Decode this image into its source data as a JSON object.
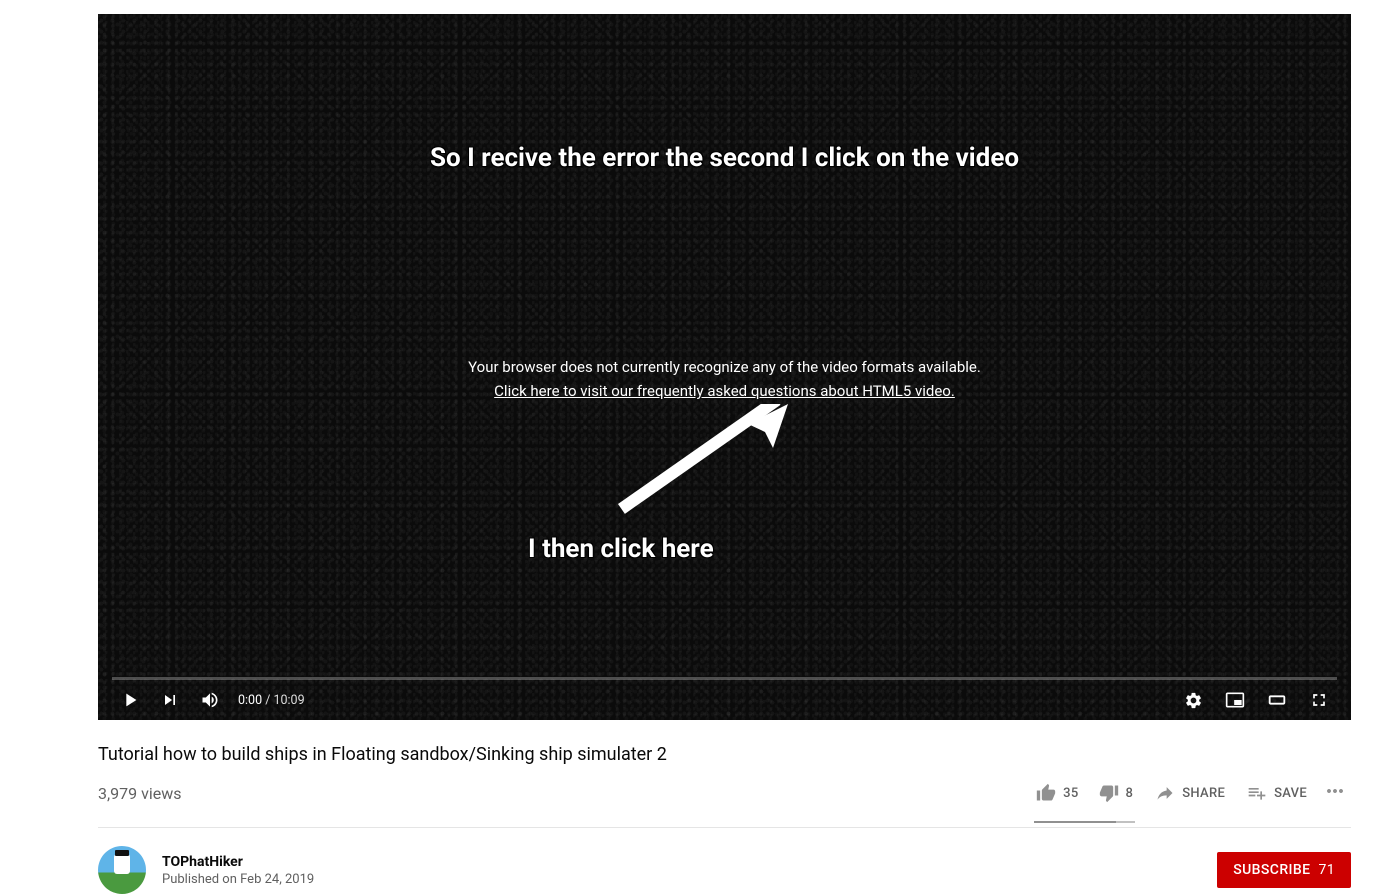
{
  "player": {
    "annotation_top": "So I recive the error the second I click on the video",
    "error_message": "Your browser does not currently recognize any of the video formats available.",
    "error_link": "Click here to visit our frequently asked questions about HTML5 video.",
    "annotation_bottom": "I then click here",
    "current_time": "0:00",
    "duration": "10:09"
  },
  "video": {
    "title": "Tutorial how to build ships in Floating sandbox/Sinking ship simulater 2",
    "views": "3,979 views",
    "likes": "35",
    "dislikes": "8",
    "share_label": "SHARE",
    "save_label": "SAVE"
  },
  "channel": {
    "name": "TOPhatHiker",
    "published": "Published on Feb 24, 2019",
    "subscribe_label": "SUBSCRIBE",
    "subscribers": "71"
  }
}
